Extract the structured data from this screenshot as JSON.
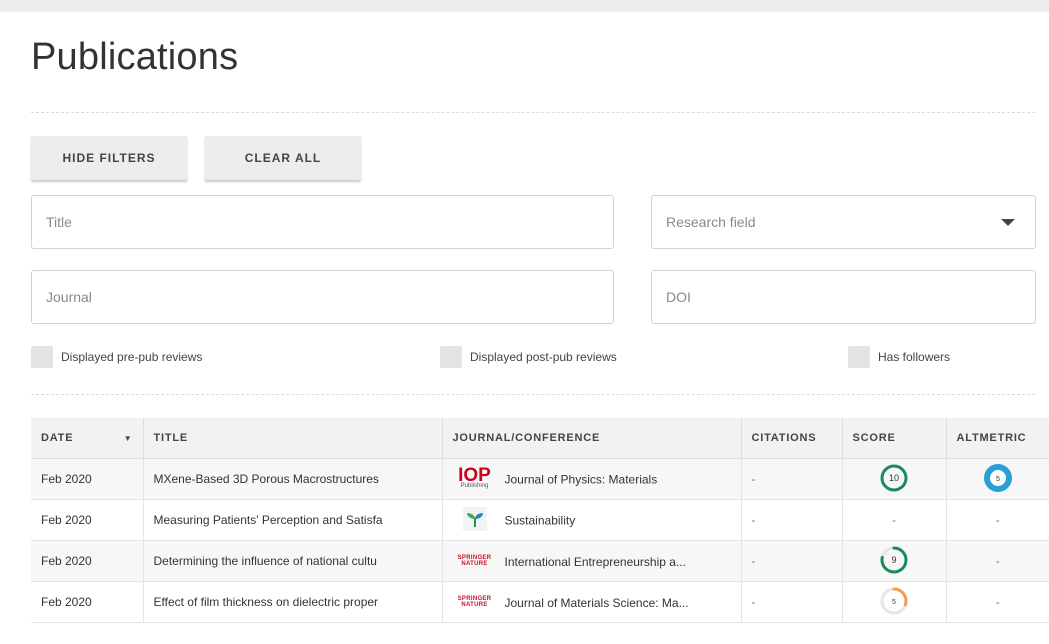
{
  "page": {
    "title": "Publications"
  },
  "filters": {
    "hide_label": "HIDE FILTERS",
    "clear_label": "CLEAR ALL",
    "title_placeholder": "Title",
    "research_field_label": "Research field",
    "journal_placeholder": "Journal",
    "doi_placeholder": "DOI",
    "checkboxes": [
      {
        "label": "Displayed pre-pub reviews"
      },
      {
        "label": "Displayed post-pub reviews"
      },
      {
        "label": "Has followers"
      }
    ]
  },
  "table": {
    "headers": {
      "date": "DATE",
      "title": "TITLE",
      "journal": "JOURNAL/CONFERENCE",
      "citations": "CITATIONS",
      "score": "SCORE",
      "altmetric": "ALTMETRIC"
    },
    "rows": [
      {
        "date": "Feb 2020",
        "title": "MXene-Based 3D Porous Macrostructures",
        "journal_logo": "iop-publishing-logo",
        "journal": "Journal of Physics: Materials",
        "citations": "-",
        "score": "10",
        "score_fraction": 1.0,
        "altmetric": "5"
      },
      {
        "date": "Feb 2020",
        "title": "Measuring Patients' Perception and Satisfa",
        "journal_logo": "sustainability-plant-logo",
        "journal": "Sustainability",
        "citations": "-",
        "score": "-",
        "altmetric": "-"
      },
      {
        "date": "Feb 2020",
        "title": "Determining the influence of national cultu",
        "journal_logo": "springer-nature-logo",
        "journal": "International Entrepreneurship a...",
        "citations": "-",
        "score": "9",
        "score_fraction": 0.78,
        "altmetric": "-"
      },
      {
        "date": "Feb 2020",
        "title": "Effect of film thickness on dielectric proper",
        "journal_logo": "springer-nature-logo",
        "journal": "Journal of Materials Science: Ma...",
        "citations": "-",
        "score": "5",
        "score_fraction": 0.3,
        "altmetric": "-"
      }
    ]
  },
  "colors": {
    "score_high": "#1b8a5a",
    "score_mid": "#f0a04b",
    "altmetric_ring": "#2a9fd6"
  },
  "iop_logo": {
    "mark": "IOP",
    "sub": "Publishing"
  },
  "springer_logo": {
    "top": "SPRINGER",
    "bottom": "NATURE"
  }
}
